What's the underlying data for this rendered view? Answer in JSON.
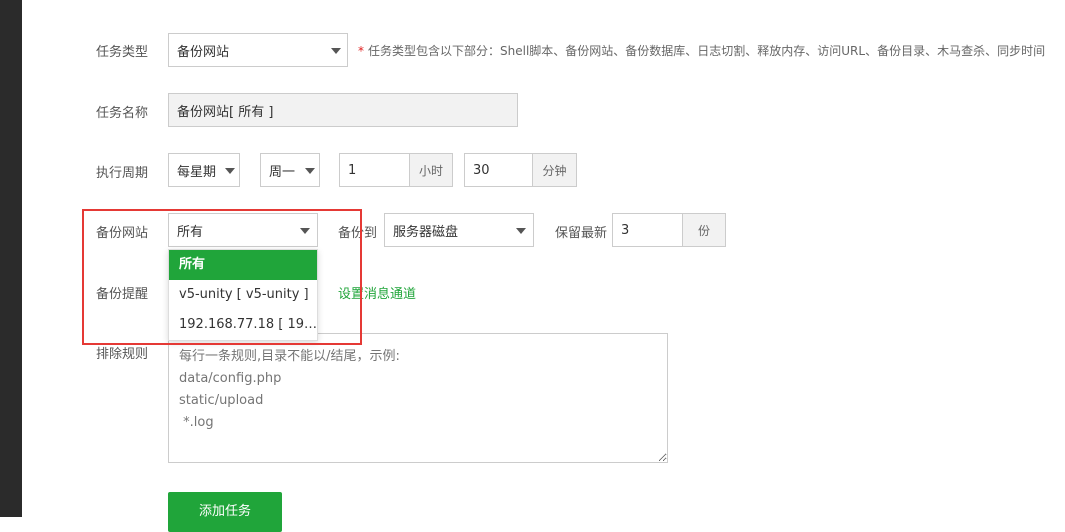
{
  "form": {
    "task_type": {
      "label": "任务类型",
      "value": "备份网站",
      "hint": "任务类型包含以下部分：Shell脚本、备份网站、备份数据库、日志切割、释放内存、访问URL、备份目录、木马查杀、同步时间"
    },
    "task_name": {
      "label": "任务名称",
      "value": "备份网站[ 所有 ]"
    },
    "period": {
      "label": "执行周期",
      "cycle": "每星期",
      "weekday": "周一",
      "hour": "1",
      "hour_unit": "小时",
      "minute": "30",
      "minute_unit": "分钟"
    },
    "backup_site": {
      "label": "备份网站",
      "value": "所有",
      "options": [
        "所有",
        "v5-unity [ v5-unity ]",
        "192.168.77.18 [ 192...."
      ]
    },
    "backup_to": {
      "label": "备份到",
      "value": "服务器磁盘"
    },
    "keep_latest": {
      "label": "保留最新",
      "value": "3",
      "unit": "份"
    },
    "backup_reminder": {
      "label": "备份提醒",
      "link": "设置消息通道"
    },
    "exclude_rules": {
      "label": "排除规则",
      "placeholder": "每行一条规则,目录不能以/结尾，示例:\ndata/config.php\nstatic/upload\n *.log"
    },
    "submit_label": "添加任务"
  }
}
